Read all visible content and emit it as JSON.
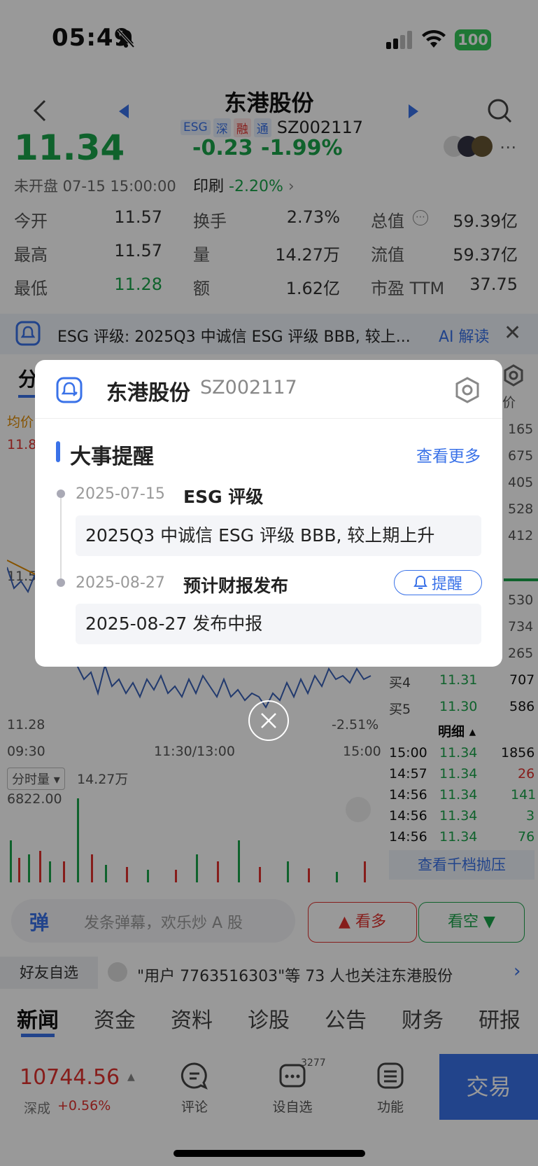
{
  "status_bar": {
    "time": "05:49",
    "battery": "100"
  },
  "header": {
    "title": "东港股份",
    "tags": [
      "ESG",
      "深",
      "融",
      "通"
    ],
    "code": "SZ002117"
  },
  "quote": {
    "price": "11.34",
    "change": "-0.23",
    "change_pct": "-1.99%",
    "market_status": "未开盘 07-15 15:00:00",
    "sector_name": "印刷",
    "sector_change": "-2.20%",
    "stats": [
      {
        "label": "今开",
        "value": "11.57"
      },
      {
        "label": "换手",
        "value": "2.73%"
      },
      {
        "label": "总值",
        "value": "59.39亿"
      },
      {
        "label": "最高",
        "value": "11.57"
      },
      {
        "label": "量",
        "value": "14.27万"
      },
      {
        "label": "流值",
        "value": "59.37亿"
      },
      {
        "label": "最低",
        "value": "11.28"
      },
      {
        "label": "额",
        "value": "1.62亿"
      },
      {
        "label": "市盈 TTM",
        "value": "37.75"
      }
    ]
  },
  "esg_banner": {
    "text": "ESG 评级: 2025Q3 中诚信 ESG 评级 BBB, 较上...",
    "ai_label": "AI 解读"
  },
  "chart": {
    "tab_label": "分",
    "avg_label": "均价",
    "price_high_label": "11.8",
    "price_mid_label": "11.5",
    "price_low_label": "11.28",
    "low_pct": "-2.51%",
    "time_start": "09:30",
    "time_mid": "11:30/13:00",
    "time_end": "15:00",
    "volume_selector": "分时量",
    "volume_total": "14.27万",
    "volume_max": "6822.00",
    "order_book_head": "价",
    "order_book_right": [
      "165",
      "675",
      "405",
      "528",
      "412",
      "530",
      "734",
      "265"
    ],
    "buy_rows": [
      {
        "label": "买4",
        "price": "11.31",
        "vol": "707"
      },
      {
        "label": "买5",
        "price": "11.30",
        "vol": "586"
      }
    ],
    "detail_label": "明细",
    "trades": [
      {
        "time": "15:00",
        "price": "11.34",
        "vol": "1856"
      },
      {
        "time": "14:57",
        "price": "11.34",
        "vol": "26"
      },
      {
        "time": "14:56",
        "price": "11.34",
        "vol": "141"
      },
      {
        "time": "14:56",
        "price": "11.34",
        "vol": "3"
      },
      {
        "time": "14:56",
        "price": "11.34",
        "vol": "76"
      }
    ],
    "depth_link": "查看千档抛压"
  },
  "social": {
    "danmu_placeholder": "发条弹幕，欢乐炒 A 股",
    "bullish": "看多",
    "bearish": "看空",
    "friends_tag": "好友自选",
    "friends_text": "\"用户 7763516303\"等 73 人也关注东港股份"
  },
  "news_tabs": [
    "新闻",
    "资金",
    "资料",
    "诊股",
    "公告",
    "财务",
    "研报"
  ],
  "bottom_bar": {
    "index_value": "10744.56",
    "index_name": "深成",
    "index_change": "+0.56%",
    "tools": [
      {
        "label": "评论"
      },
      {
        "label": "设自选",
        "badge": "3277"
      },
      {
        "label": "功能"
      }
    ],
    "trade": "交易"
  },
  "modal": {
    "stock_name": "东港股份",
    "stock_code": "SZ002117",
    "section_title": "大事提醒",
    "view_more": "查看更多",
    "events": [
      {
        "date": "2025-07-15",
        "title": "ESG 评级",
        "detail": "2025Q3 中诚信 ESG 评级 BBB, 较上期上升"
      },
      {
        "date": "2025-08-27",
        "title": "预计财报发布",
        "detail": "2025-08-27 发布中报",
        "action": "提醒"
      }
    ]
  },
  "colors": {
    "accent": "#3a72e8",
    "up": "#e0312d",
    "down": "#1aa34a"
  }
}
